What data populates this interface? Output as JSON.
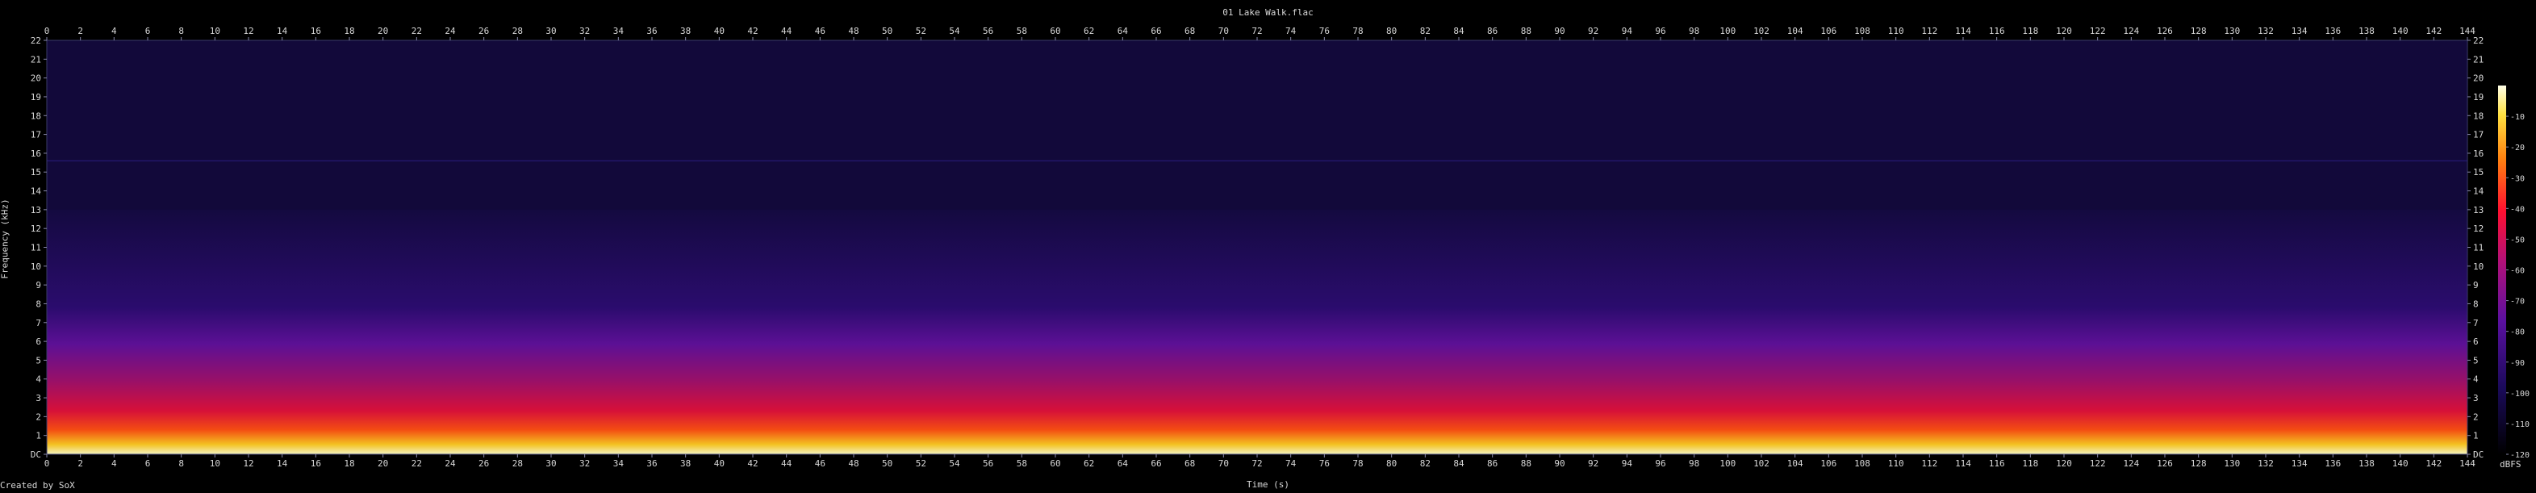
{
  "title": "01 Lake Walk.flac",
  "credit": "Created by SoX",
  "chart_data": {
    "type": "heatmap",
    "title": "01 Lake Walk.flac",
    "xlabel": "Time (s)",
    "ylabel": "Frequency (kHz)",
    "colorbar_label": "dBFS",
    "xlim": [
      0,
      144
    ],
    "ylim": [
      0,
      22
    ],
    "x_ticks": [
      0,
      2,
      4,
      6,
      8,
      10,
      12,
      14,
      16,
      18,
      20,
      22,
      24,
      26,
      28,
      30,
      32,
      34,
      36,
      38,
      40,
      42,
      44,
      46,
      48,
      50,
      52,
      54,
      56,
      58,
      60,
      62,
      64,
      66,
      68,
      70,
      72,
      74,
      76,
      78,
      80,
      82,
      84,
      86,
      88,
      90,
      92,
      94,
      96,
      98,
      100,
      102,
      104,
      106,
      108,
      110,
      112,
      114,
      116,
      118,
      120,
      122,
      124,
      126,
      128,
      130,
      132,
      134,
      136,
      138,
      140,
      142,
      144
    ],
    "y_ticks": [
      1,
      2,
      3,
      4,
      5,
      6,
      7,
      8,
      9,
      10,
      11,
      12,
      13,
      14,
      15,
      16,
      17,
      18,
      19,
      20,
      21,
      22
    ],
    "y_zero_label": "DC",
    "colorbar_ticks": [
      -10,
      -20,
      -30,
      -40,
      -50,
      -60,
      -70,
      -80,
      -90,
      -100,
      -110,
      -120
    ],
    "colorbar_range": [
      -120,
      0
    ],
    "colors": {
      "background": "#000000",
      "axis": "#3a3a6a",
      "text": "#d8d8d8"
    }
  }
}
